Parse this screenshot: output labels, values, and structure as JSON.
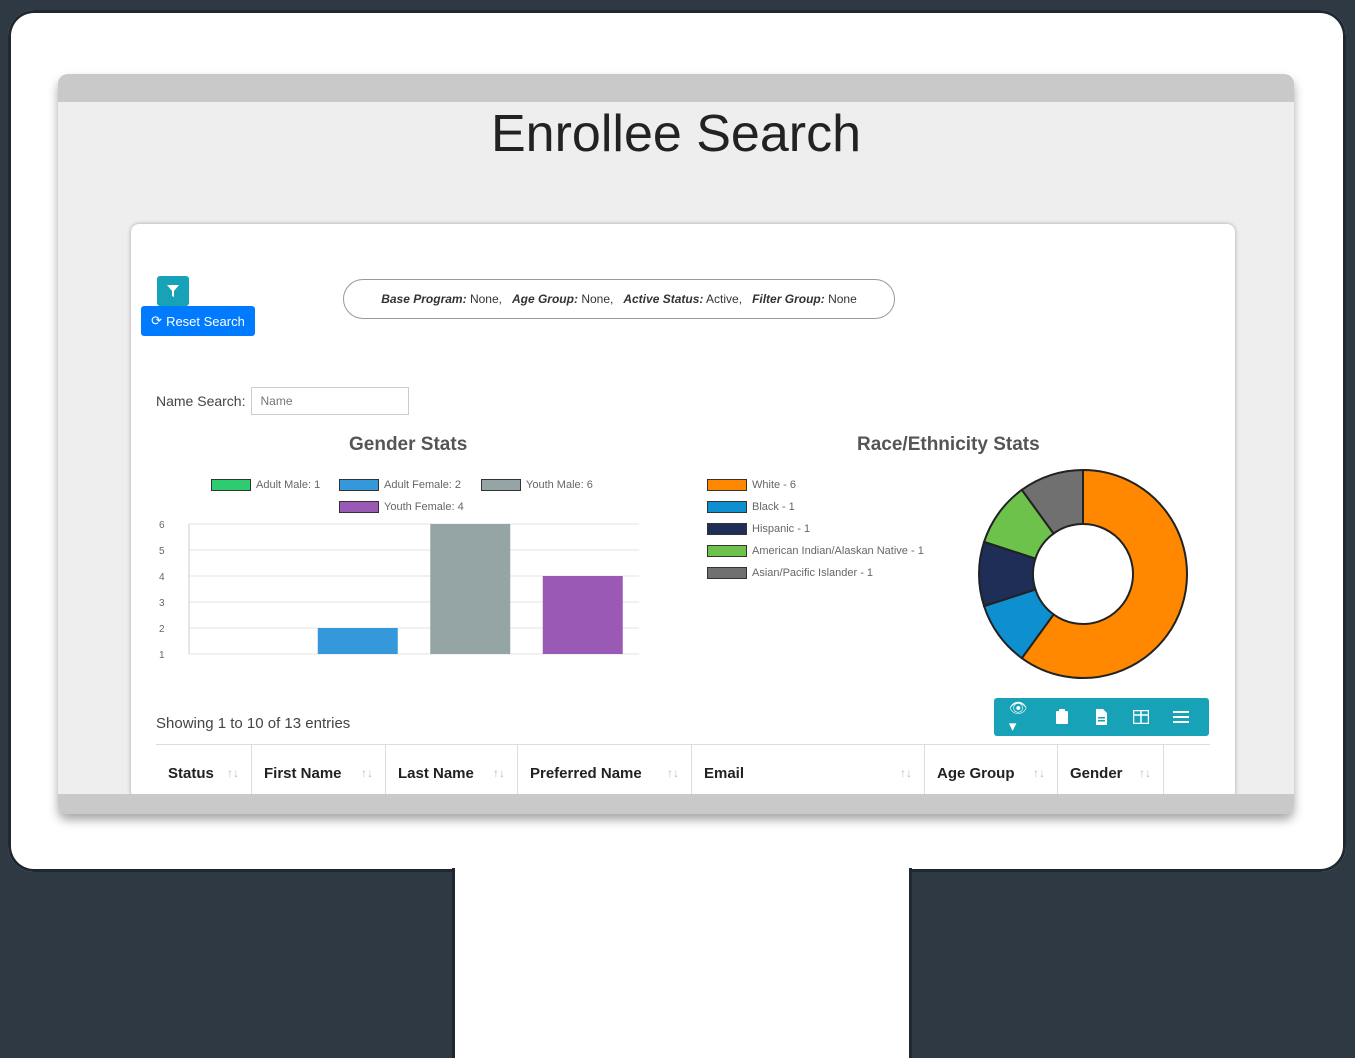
{
  "page": {
    "title": "Enrollee Search"
  },
  "toolbar": {
    "reset_label": "Reset Search"
  },
  "filters": [
    {
      "label": "Base Program:",
      "value": "None,"
    },
    {
      "label": "Age Group:",
      "value": "None,"
    },
    {
      "label": "Active Status:",
      "value": "Active,"
    },
    {
      "label": "Filter Group:",
      "value": "None"
    }
  ],
  "name_search": {
    "label": "Name Search:",
    "placeholder": "Name"
  },
  "gender_chart_title": "Gender Stats",
  "race_chart_title": "Race/Ethnicity Stats",
  "chart_data": [
    {
      "type": "bar",
      "title": "Gender Stats",
      "series": [
        {
          "name": "Adult Male: 1",
          "value": 1,
          "color": "#2ecc71"
        },
        {
          "name": "Adult Female: 2",
          "value": 2,
          "color": "#3498db"
        },
        {
          "name": "Youth Male: 6",
          "value": 6,
          "color": "#95a5a6"
        },
        {
          "name": "Youth Female: 4",
          "value": 4,
          "color": "#9b59b6"
        }
      ],
      "yticks": [
        "6",
        "5",
        "4",
        "3",
        "2",
        "1"
      ],
      "ylim": [
        1,
        6
      ],
      "grid": true,
      "legend": "top"
    },
    {
      "type": "pie",
      "title": "Race/Ethnicity Stats",
      "series": [
        {
          "name": "White - 6",
          "value": 6,
          "color": "#ff8800"
        },
        {
          "name": "Black - 1",
          "value": 1,
          "color": "#0e8fd0"
        },
        {
          "name": "Hispanic - 1",
          "value": 1,
          "color": "#1f2e57"
        },
        {
          "name": "American Indian/Alaskan Native - 1",
          "value": 1,
          "color": "#6cc24a"
        },
        {
          "name": "Asian/Pacific Islander - 1",
          "value": 1,
          "color": "#707070"
        }
      ],
      "legend": "left"
    }
  ],
  "table": {
    "info": "Showing 1 to 10 of 13 entries",
    "columns": [
      "Status",
      "First Name",
      "Last Name",
      "Preferred Name",
      "Email",
      "Age Group",
      "Gender"
    ]
  },
  "icons": [
    "filter-icon",
    "refresh-icon",
    "eye-icon",
    "clipboard-icon",
    "file-icon",
    "table-icon",
    "list-icon"
  ]
}
